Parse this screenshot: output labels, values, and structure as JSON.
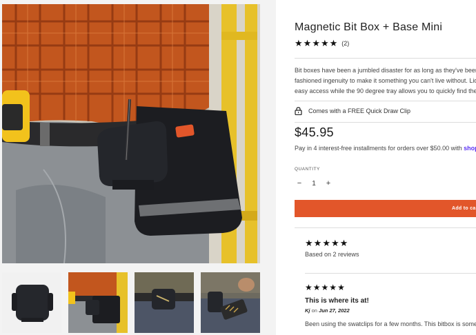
{
  "product": {
    "title": "Magnetic Bit Box + Base Mini",
    "rating_stars": 5,
    "rating_count": "(2)",
    "description_lines": [
      "Bit boxes have been a jumbled disaster for as long as they've been",
      "fashioned ingenuity to make it something you can't live without. Lid",
      "easy access while the 90 degree tray allows you to quickly find the r"
    ],
    "promo_text": "Comes with a FREE Quick Draw Clip",
    "price": "$45.95",
    "installments_text": "Pay in 4 interest-free installments for orders over $50.00 with",
    "installments_brand": "shop",
    "quantity_label": "QUANTITY",
    "quantity_value": "1",
    "quantity_minus": "−",
    "quantity_plus": "+",
    "add_to_cart": "Add to ca"
  },
  "reviews_summary": {
    "stars": 5,
    "based_on": "Based on 2 reviews"
  },
  "review": {
    "stars": 5,
    "title": "This is where its at!",
    "author": "Kj",
    "on_text": "on",
    "date": "Jun 27, 2022",
    "body": "Been using the swatclips for a few months. This bitbox is some"
  },
  "colors": {
    "accent": "#e2562a",
    "shop_pay": "#5a31f4",
    "flannel": "#c2561e",
    "bag": "#1c1d21",
    "tape_yellow": "#f2c21c"
  },
  "icons": {
    "star": "★",
    "lock": "lock-icon"
  }
}
